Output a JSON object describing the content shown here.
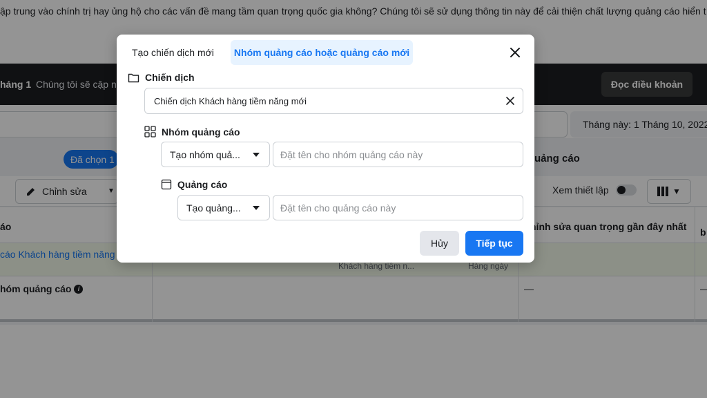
{
  "background": {
    "notice_text": "ập trung vào chính trị hay ủng hộ cho các vấn đề mang tầm quan trọng quốc gia không? Chúng tôi sẽ sử dụng thông tin này để cải thiện chất lượng quảng cáo hiển t",
    "banner": {
      "label_bold": "háng 1",
      "label_text": "Chúng tôi sẽ cập n",
      "terms_button": "Đọc điều khoản"
    },
    "date_range": "Tháng này: 1 Tháng 10, 2022",
    "selected_pill": "Đã chọn 1",
    "right_title": "uảng cáo",
    "toolbar": {
      "edit_label": "Chỉnh sửa",
      "view_setup_label": "Xem thiết lập"
    },
    "table": {
      "header_col1": "áo",
      "header_col2": "hỉnh sửa quan trọng gần đây nhất",
      "header_col3": "b",
      "row1_name": "cáo Khách hàng tiềm năng r",
      "row1_sub1": "Khách hàng tiềm n...",
      "row1_sub2": "Hàng ngày",
      "row2_name": "hóm quảng cáo",
      "row2_dash1": "—",
      "row2_dash2": "—"
    }
  },
  "modal": {
    "tabs": [
      {
        "label": "Tạo chiến dịch mới",
        "active": false
      },
      {
        "label": "Nhóm quảng cáo hoặc quảng cáo mới",
        "active": true
      }
    ],
    "campaign": {
      "heading": "Chiến dịch",
      "value": "Chiến dịch Khách hàng tiềm năng mới"
    },
    "ad_set": {
      "heading": "Nhóm quảng cáo",
      "select_label": "Tạo nhóm quả...",
      "placeholder": "Đặt tên cho nhóm quảng cáo này"
    },
    "ad": {
      "heading": "Quảng cáo",
      "select_label": "Tạo quảng...",
      "placeholder": "Đặt tên cho quảng cáo này"
    },
    "buttons": {
      "cancel": "Hủy",
      "continue": "Tiếp tục"
    }
  },
  "colors": {
    "accent": "#1877f2",
    "accent_tint": "#e7f3ff",
    "overlay": "rgba(0,0,0,0.42)"
  }
}
